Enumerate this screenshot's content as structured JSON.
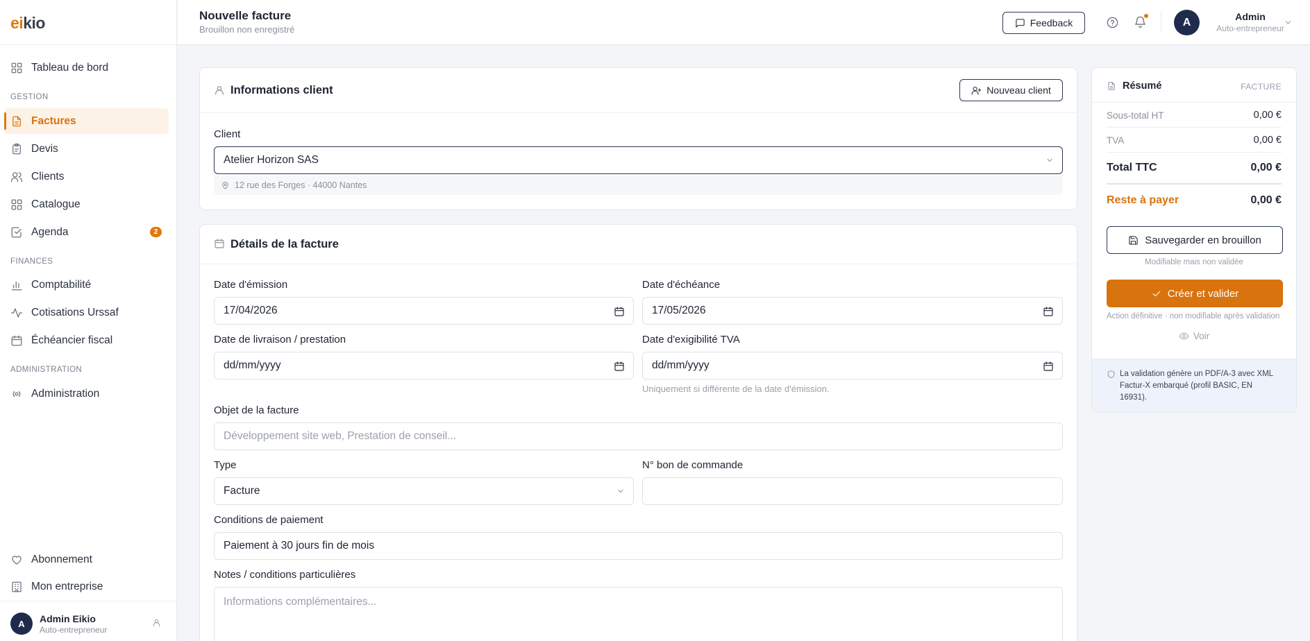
{
  "brand": {
    "logo_prefix": "ei",
    "logo_suffix": "kio",
    "accent": "#e07a0c"
  },
  "sidebar": {
    "top_item": {
      "label": "Tableau de bord",
      "icon": "grid-icon"
    },
    "sections": [
      {
        "title": "GESTION"
      },
      {
        "title": "FINANCES"
      },
      {
        "title": "ADMINISTRATION"
      }
    ],
    "items": [
      {
        "label": "Factures",
        "icon": "file-icon",
        "active": true
      },
      {
        "label": "Devis",
        "icon": "clipboard-icon"
      },
      {
        "label": "Clients",
        "icon": "users-icon"
      },
      {
        "label": "Catalogue",
        "icon": "grid-icon"
      },
      {
        "label": "Agenda",
        "icon": "check-square-icon",
        "badge": "2"
      },
      {
        "label": "Comptabilité",
        "icon": "bar-chart-icon"
      },
      {
        "label": "Cotisations Urssaf",
        "icon": "activity-icon"
      },
      {
        "label": "Échéancier fiscal",
        "icon": "calendar-icon"
      },
      {
        "label": "Administration",
        "icon": "radio-icon"
      }
    ],
    "bottom_items": [
      {
        "label": "Abonnement",
        "icon": "heart-icon"
      },
      {
        "label": "Mon entreprise",
        "icon": "building-icon"
      }
    ],
    "user": {
      "initial": "A",
      "name": "Admin Eikio",
      "role": "Auto-entrepreneur"
    }
  },
  "header": {
    "title": "Nouvelle facture",
    "subtitle": "Brouillon non enregistré",
    "feedback_label": "Feedback",
    "user": {
      "initial": "A",
      "name": "Admin",
      "role": "Auto-entrepreneur"
    }
  },
  "client_card": {
    "title": "Informations client",
    "new_client_label": "Nouveau client",
    "client_label": "Client",
    "client_value": "Atelier Horizon SAS",
    "address": "12 rue des Forges · 44000 Nantes"
  },
  "details_card": {
    "title": "Détails de la facture",
    "issue_date_label": "Date d'émission",
    "issue_date_value": "17/04/2026",
    "due_date_label": "Date d'échéance",
    "due_date_value": "17/05/2026",
    "delivery_date_label": "Date de livraison / prestation",
    "delivery_date_placeholder": "dd/mm/yyyy",
    "vat_date_label": "Date d'exigibilité TVA",
    "vat_date_placeholder": "dd/mm/yyyy",
    "vat_date_hint": "Uniquement si différente de la date d'émission.",
    "subject_label": "Objet de la facture",
    "subject_placeholder": "Développement site web, Prestation de conseil...",
    "type_label": "Type",
    "type_value": "Facture",
    "po_label": "N° bon de commande",
    "po_value": "",
    "payment_label": "Conditions de paiement",
    "payment_value": "Paiement à 30 jours fin de mois",
    "notes_label": "Notes / conditions particulières",
    "notes_placeholder": "Informations complémentaires..."
  },
  "summary": {
    "title": "Résumé",
    "doc_type": "FACTURE",
    "subtotal_label": "Sous-total HT",
    "subtotal_value": "0,00 €",
    "vat_label": "TVA",
    "vat_value": "0,00 €",
    "total_label": "Total TTC",
    "total_value": "0,00 €",
    "remaining_label": "Reste à payer",
    "remaining_value": "0,00 €",
    "save_draft_label": "Sauvegarder en brouillon",
    "save_draft_hint": "Modifiable mais non validée",
    "create_label": "Créer et valider",
    "create_hint": "Action définitive · non modifiable après validation",
    "view_label": "Voir",
    "note": "La validation génère un PDF/A-3 avec XML Factur-X embarqué (profil BASIC, EN 16931).",
    "remaining_color": "#d9730d"
  }
}
